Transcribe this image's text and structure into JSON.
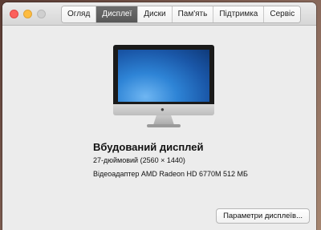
{
  "tabs": [
    {
      "label": "Огляд"
    },
    {
      "label": "Дисплеї"
    },
    {
      "label": "Диски"
    },
    {
      "label": "Пам'ять"
    },
    {
      "label": "Підтримка"
    },
    {
      "label": "Сервіс"
    }
  ],
  "active_tab": "Дисплеї",
  "display": {
    "title": "Вбудований дисплей",
    "size": "27-дюймовий (2560 × 1440)",
    "gpu": "Відеоадаптер AMD Radeon HD 6770M 512 МБ"
  },
  "actions": {
    "settings_button": "Параметри дисплеїв..."
  },
  "icons": {
    "close": "close-icon",
    "minimize": "minimize-icon",
    "zoom": "zoom-icon",
    "device": "imac-icon"
  },
  "colors": {
    "active_tab_bg": "#5f5f5f",
    "close": "#fc605c",
    "minimize": "#fdbc40"
  }
}
